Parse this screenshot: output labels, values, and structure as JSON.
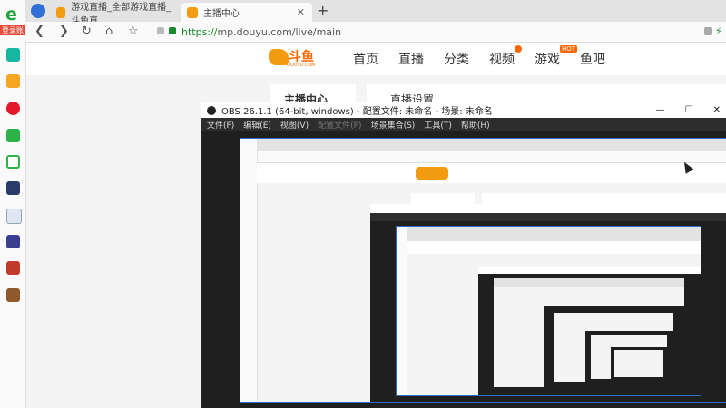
{
  "browser": {
    "tabs": [
      {
        "title": "游戏直播_全部游戏直播_斗鱼直",
        "active": false
      },
      {
        "title": "主播中心",
        "active": true
      }
    ],
    "new_tab": "+",
    "url_scheme": "https://",
    "url_rest": "mp.douyu.com/live/main",
    "buttons": {
      "back": "❮",
      "forward": "❯",
      "reload": "↻",
      "home": "⌂",
      "star": "☆"
    }
  },
  "sidebar": {
    "login_badge": "登录账号",
    "icons": [
      "ie-icon",
      "plus-icon",
      "star-icon",
      "weibo-icon",
      "mail-icon",
      "cloud-icon",
      "game-icon",
      "doc-icon",
      "game2-icon",
      "game3-icon",
      "game4-icon"
    ]
  },
  "douyu": {
    "logo": "斗鱼",
    "logo_sub": "DOUYU.COM",
    "nav": [
      "首页",
      "直播",
      "分类",
      "视频",
      "游戏",
      "鱼吧"
    ],
    "hot_badge": "HOT",
    "side_title": "主播中心",
    "main_title": "直播设置"
  },
  "obs": {
    "title": "OBS 26.1.1 (64-bit, windows) - 配置文件: 未命名 - 场景: 未命名",
    "menu": [
      "文件(F)",
      "编辑(E)",
      "视图(V)",
      "配置文件(P)",
      "场景集合(S)",
      "工具(T)",
      "帮助(H)"
    ],
    "controls": {
      "min": "—",
      "max": "☐",
      "close": "✕"
    }
  },
  "colors": {
    "accent_orange": "#ff6a00",
    "obs_dark": "#2d2d2d",
    "url_green": "#1a8a2d",
    "preview_border": "#2e6cc2"
  }
}
